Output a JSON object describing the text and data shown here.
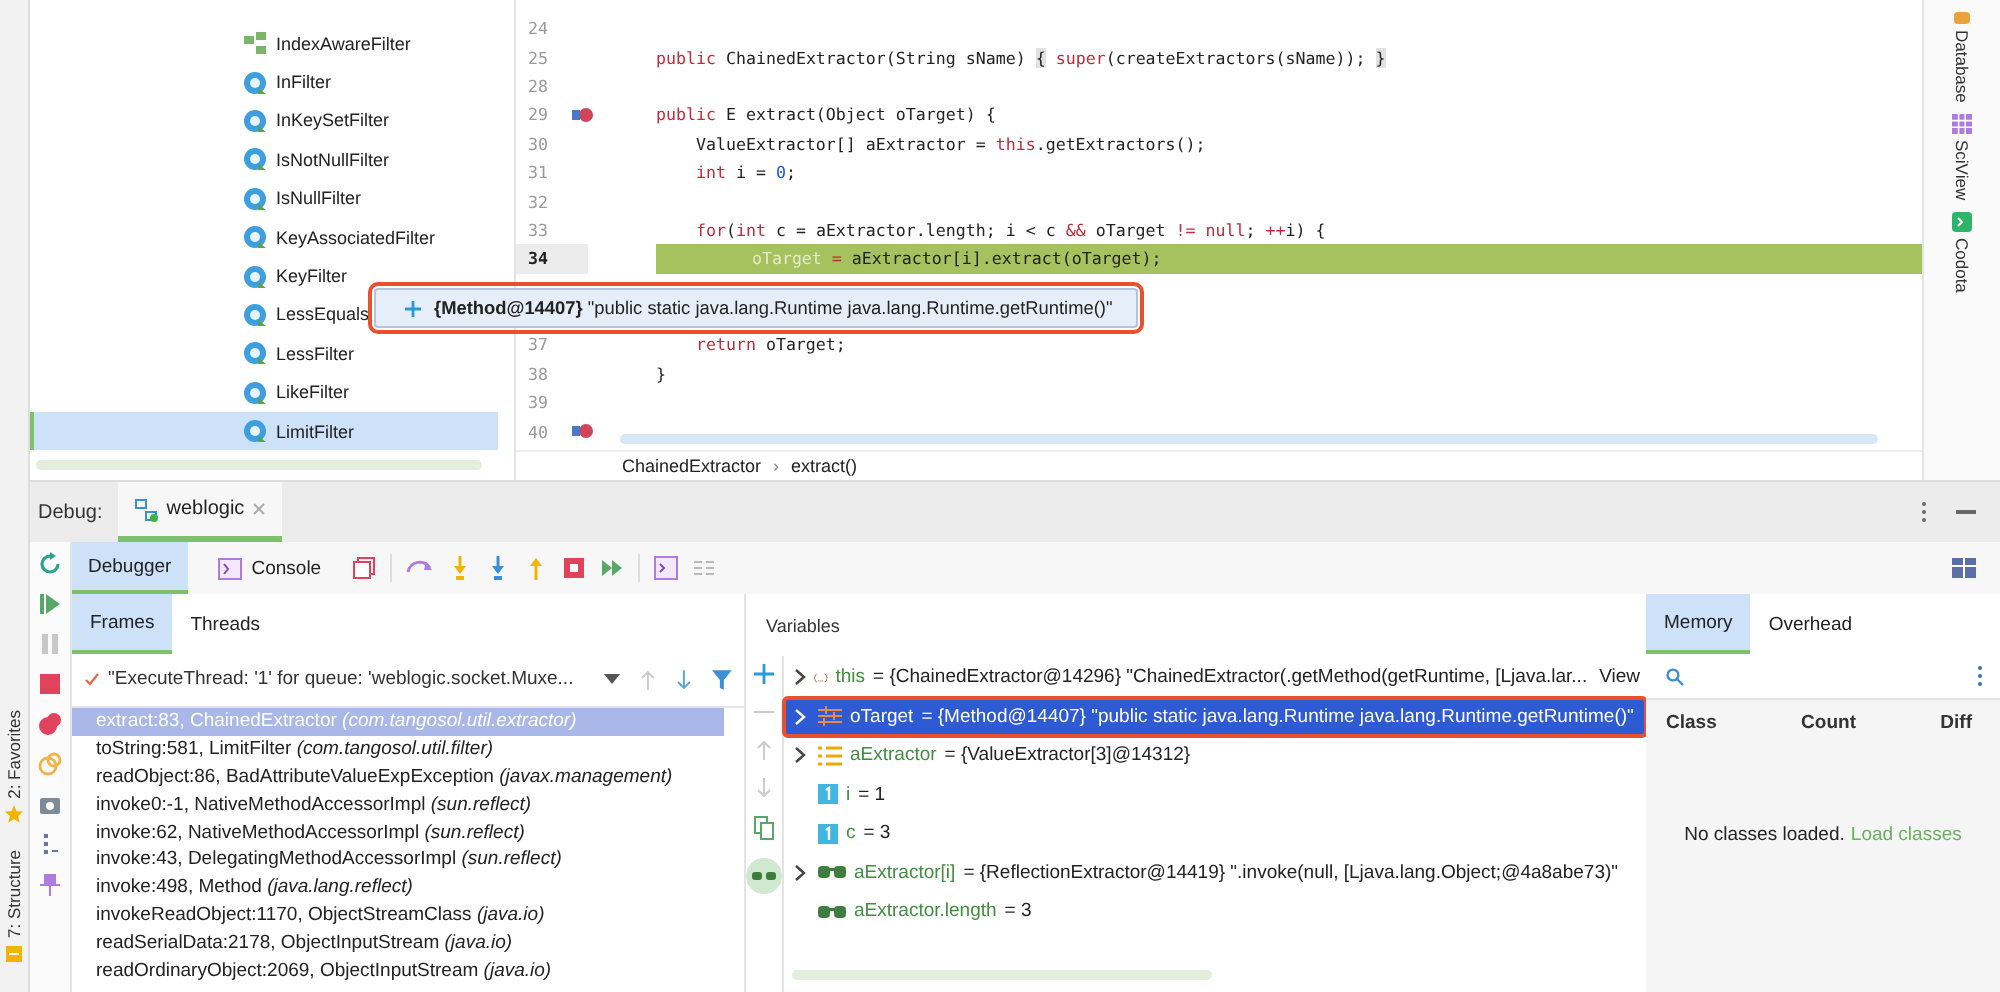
{
  "project_tree": {
    "items": [
      {
        "label": "IndexAwareFilter",
        "kind": "interface",
        "selected": false
      },
      {
        "label": "InFilter",
        "kind": "class",
        "selected": false
      },
      {
        "label": "InKeySetFilter",
        "kind": "class",
        "selected": false
      },
      {
        "label": "IsNotNullFilter",
        "kind": "class",
        "selected": false
      },
      {
        "label": "IsNullFilter",
        "kind": "class",
        "selected": false
      },
      {
        "label": "KeyAssociatedFilter",
        "kind": "class",
        "selected": false
      },
      {
        "label": "KeyFilter",
        "kind": "class",
        "selected": false
      },
      {
        "label": "LessEquals",
        "kind": "class",
        "selected": false
      },
      {
        "label": "LessFilter",
        "kind": "class",
        "selected": false
      },
      {
        "label": "LikeFilter",
        "kind": "class",
        "selected": false
      },
      {
        "label": "LimitFilter",
        "kind": "class",
        "selected": true
      }
    ]
  },
  "editor": {
    "lines": [
      {
        "number": "24",
        "current": false,
        "marked": false
      },
      {
        "number": "25",
        "current": false,
        "marked": false,
        "segments": [
          {
            "text": "public",
            "kind": "kw"
          },
          {
            "text": " ChainedExtractor(String sName) ",
            "kind": "plain"
          },
          {
            "text": "{",
            "kind": "brace"
          },
          {
            "text": " super",
            "kind": "kw"
          },
          {
            "text": "(createExtractors(sName)); ",
            "kind": "plain"
          },
          {
            "text": "}",
            "kind": "brace"
          }
        ]
      },
      {
        "number": "28",
        "current": false,
        "marked": false
      },
      {
        "number": "29",
        "current": false,
        "marked": true,
        "segments": [
          {
            "text": "public",
            "kind": "kw"
          },
          {
            "text": " E extract(Object oTarget) {",
            "kind": "plain"
          }
        ]
      },
      {
        "number": "30",
        "current": false,
        "marked": false,
        "segments": [
          {
            "text": "    ValueExtractor[] aExtractor = ",
            "kind": "plain"
          },
          {
            "text": "this",
            "kind": "kw"
          },
          {
            "text": ".getExtractors();",
            "kind": "plain"
          }
        ]
      },
      {
        "number": "31",
        "current": false,
        "marked": false,
        "segments": [
          {
            "text": "    int",
            "kind": "kw"
          },
          {
            "text": " i = ",
            "kind": "plain"
          },
          {
            "text": "0",
            "kind": "num"
          },
          {
            "text": ";",
            "kind": "plain"
          }
        ]
      },
      {
        "number": "32",
        "current": false,
        "marked": false
      },
      {
        "number": "33",
        "current": false,
        "marked": false,
        "segments": [
          {
            "text": "    for",
            "kind": "kw"
          },
          {
            "text": "(",
            "kind": "plain"
          },
          {
            "text": "int",
            "kind": "kw"
          },
          {
            "text": " c = aExtractor.length; i < c ",
            "kind": "plain"
          },
          {
            "text": "&&",
            "kind": "kw"
          },
          {
            "text": " oTarget ",
            "kind": "plain"
          },
          {
            "text": "!=",
            "kind": "kw"
          },
          {
            "text": " null",
            "kind": "kw"
          },
          {
            "text": "; ",
            "kind": "plain"
          },
          {
            "text": "++",
            "kind": "kw"
          },
          {
            "text": "i) {",
            "kind": "plain"
          }
        ]
      },
      {
        "number": "34",
        "current": true,
        "marked": false,
        "segments": [
          {
            "text": "        oTarget",
            "kind": "dim"
          },
          {
            "text": " =",
            "kind": "kw"
          },
          {
            "text": " aExtractor[i].extract(oTarget);",
            "kind": "plain"
          }
        ]
      },
      {
        "current": false
      },
      {
        "current": false
      },
      {
        "number": "37",
        "current": false,
        "marked": false,
        "segments": [
          {
            "text": "    return",
            "kind": "kw"
          },
          {
            "text": " oTarget;",
            "kind": "plain"
          }
        ]
      },
      {
        "number": "38",
        "current": false,
        "marked": false,
        "segments": [
          {
            "text": "}",
            "kind": "plain"
          }
        ]
      },
      {
        "number": "39",
        "current": false,
        "marked": false
      },
      {
        "number": "40",
        "current": false,
        "marked": true
      }
    ],
    "breadcrumb": [
      "ChainedExtractor",
      "extract()"
    ],
    "separator": "›"
  },
  "value_popup": {
    "text": "**{Method@14407}** \"public static java.lang.Runtime java.lang.Runtime.getRuntime()\"",
    "highlighted": true
  },
  "right_tool_strip": [
    {
      "label": "Database"
    },
    {
      "label": "SciView"
    },
    {
      "label": "Codota"
    }
  ],
  "left_tool_strip": [
    {
      "label": "2: Favorites"
    },
    {
      "label": "7: Structure"
    }
  ],
  "debug": {
    "label": "Debug:",
    "tabs": [
      {
        "label": "weblogic",
        "selected": true
      }
    ]
  },
  "debugger_tabs": [
    {
      "label": "Debugger",
      "selected": true
    },
    {
      "label": "Console",
      "selected": false
    }
  ],
  "frames_tabs": [
    {
      "label": "Frames",
      "selected": true
    },
    {
      "label": "Threads",
      "selected": false
    }
  ],
  "thread": {
    "value": "\"ExecuteThread: '1' for queue: 'weblogic.socket.Muxe..."
  },
  "frames": [
    {
      "text": "extract:83, ChainedExtractor *(com.tangosol.util.extractor)*",
      "selected": true
    },
    {
      "text": "toString:581, LimitFilter *(com.tangosol.util.filter)*",
      "selected": false
    },
    {
      "text": "readObject:86, BadAttributeValueExpException *(javax.management)*",
      "selected": false
    },
    {
      "text": "invoke0:-1, NativeMethodAccessorImpl *(sun.reflect)*",
      "selected": false
    },
    {
      "text": "invoke:62, NativeMethodAccessorImpl *(sun.reflect)*",
      "selected": false
    },
    {
      "text": "invoke:43, DelegatingMethodAccessorImpl *(sun.reflect)*",
      "selected": false
    },
    {
      "text": "invoke:498, Method *(java.lang.reflect)*",
      "selected": false
    },
    {
      "text": "invokeReadObject:1170, ObjectStreamClass *(java.io)*",
      "selected": false
    },
    {
      "text": "readSerialData:2178, ObjectInputStream *(java.io)*",
      "selected": false
    },
    {
      "text": "readOrdinaryObject:2069, ObjectInputStream *(java.io)*",
      "selected": false
    }
  ],
  "variables": {
    "title": "Variables",
    "rows": [
      {
        "kind": "object",
        "expandable": true,
        "name": "this",
        "value": "= {ChainedExtractor@14296} \"ChainedExtractor(.getMethod(getRuntime, [Ljava.lar...",
        "link": "View",
        "selected": false,
        "highlighted": false
      },
      {
        "kind": "field",
        "expandable": true,
        "name": "oTarget",
        "value": "= {Method@14407} \"public static java.lang.Runtime java.lang.Runtime.getRuntime()\"",
        "selected": true,
        "highlighted": true
      },
      {
        "kind": "array",
        "expandable": true,
        "name": "aExtractor",
        "value": "= {ValueExtractor[3]@14312}",
        "selected": false,
        "highlighted": false
      },
      {
        "kind": "primitive",
        "expandable": false,
        "name": "i",
        "value": "= 1",
        "selected": false,
        "highlighted": false
      },
      {
        "kind": "primitive",
        "expandable": false,
        "name": "c",
        "value": "= 3",
        "selected": false,
        "highlighted": false
      },
      {
        "kind": "watch",
        "expandable": true,
        "name": "aExtractor[i]",
        "value": "= {ReflectionExtractor@14419} \".invoke(null, [Ljava.lang.Object;@4a8abe73)\"",
        "selected": false,
        "highlighted": false
      },
      {
        "kind": "watch",
        "expandable": false,
        "name": "aExtractor.length",
        "value": "= 3",
        "selected": false,
        "highlighted": false
      }
    ]
  },
  "memory": {
    "tabs": [
      {
        "label": "Memory",
        "selected": true
      },
      {
        "label": "Overhead",
        "selected": false
      }
    ],
    "columns": [
      "Class",
      "Count",
      "Diff"
    ],
    "empty_text": "No classes loaded.",
    "link": "Load classes"
  }
}
